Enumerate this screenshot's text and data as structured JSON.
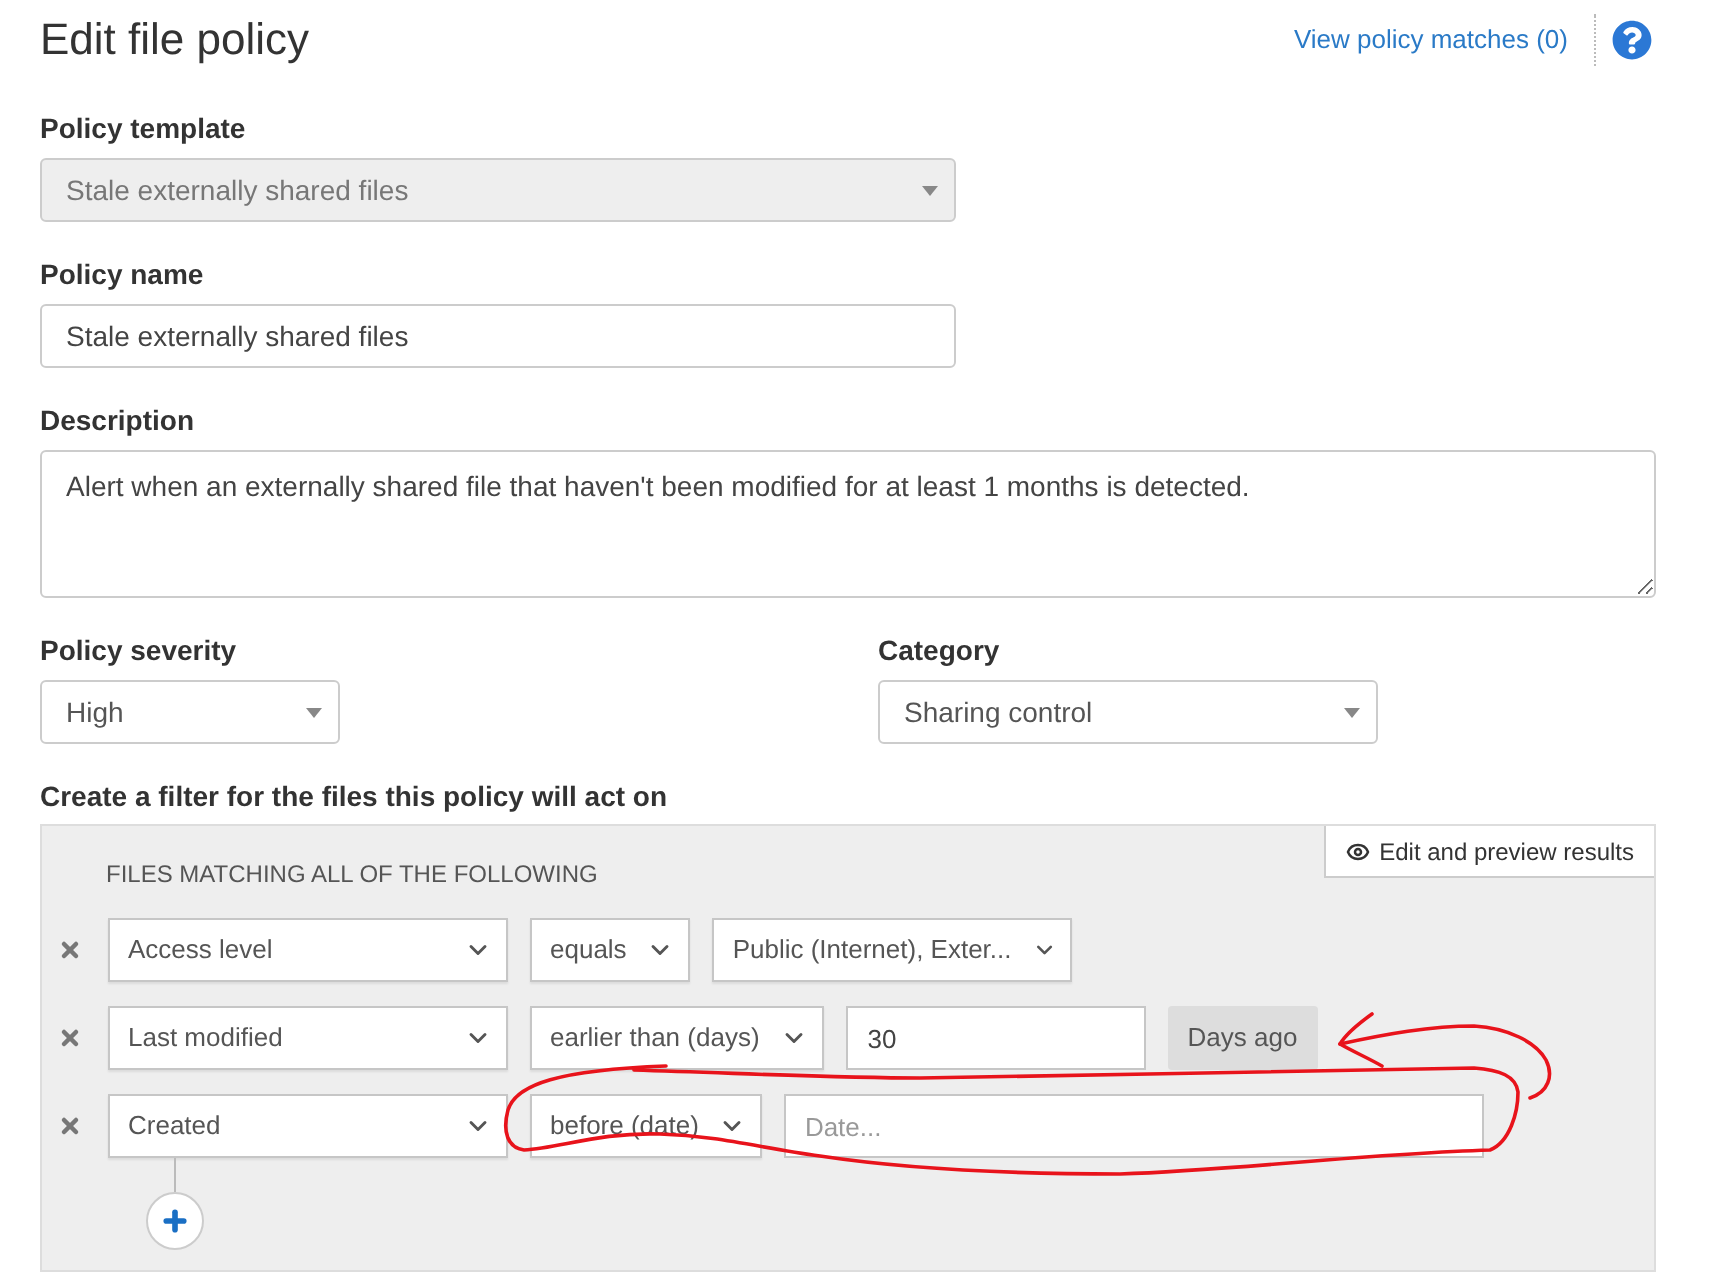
{
  "header": {
    "title": "Edit file policy",
    "link": "View policy matches (0)"
  },
  "policy_template": {
    "label": "Policy template",
    "value": "Stale externally shared files",
    "disabled": true
  },
  "policy_name": {
    "label": "Policy name",
    "value": "Stale externally shared files"
  },
  "description": {
    "label": "Description",
    "value": "Alert when an externally shared file that haven't been modified for at least 1 months is detected."
  },
  "policy_severity": {
    "label": "Policy severity",
    "value": "High"
  },
  "category": {
    "label": "Category",
    "value": "Sharing control"
  },
  "filter": {
    "label": "Create a filter for the files this policy will act on",
    "preview_button": "Edit and preview results",
    "heading": "FILES MATCHING ALL OF THE FOLLOWING",
    "rows": [
      {
        "field": "Access level",
        "operator": "equals",
        "value": {
          "kind": "select",
          "text": "Public (Internet), Exter..."
        }
      },
      {
        "field": "Last modified",
        "operator": "earlier than (days)",
        "value": {
          "kind": "number",
          "text": "30",
          "suffix": "Days ago"
        }
      },
      {
        "field": "Created",
        "operator": "before (date)",
        "value": {
          "kind": "date",
          "placeholder": "Date..."
        }
      }
    ]
  }
}
